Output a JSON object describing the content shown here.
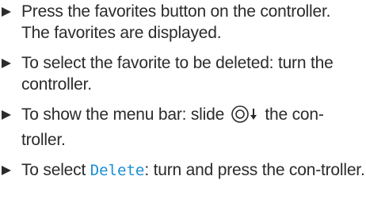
{
  "steps": [
    {
      "text": "Press the favorites button on the controller.",
      "result": "The favorites are displayed."
    },
    {
      "text": "To select the favorite to be deleted: turn the controller."
    },
    {
      "before": "To show the menu bar: slide",
      "icon": "controller-slide-down-icon",
      "after": "the con-troller."
    },
    {
      "before": "To select",
      "key": "Delete",
      "after": ": turn and press the con-troller."
    }
  ]
}
